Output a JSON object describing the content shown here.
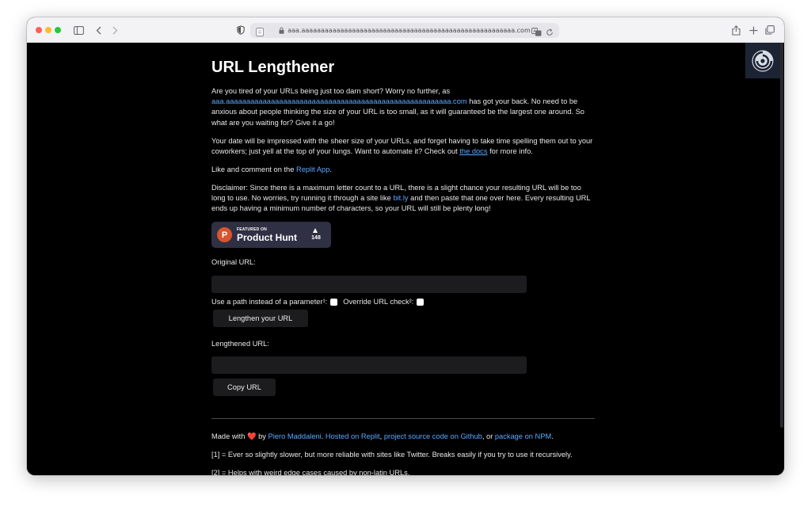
{
  "browser": {
    "url": "aaa.aaaaaaaaaaaaaaaaaaaaaaaaaaaaaaaaaaaaaaaaaaaaaaaaaaaaaaa.com"
  },
  "page": {
    "title": "URL Lengthener",
    "intro": {
      "before": "Are you tired of your URLs being just too darn short? Worry no further, as ",
      "link": "aaa.aaaaaaaaaaaaaaaaaaaaaaaaaaaaaaaaaaaaaaaaaaaaaaaaaaaaaaa.com",
      "after": " has got your back. No need to be anxious about people thinking the size of your URL is too small, as it will guaranteed be the largest one around. So what are you waiting for? Give it a go!"
    },
    "date": {
      "before": "Your date will be impressed with the sheer size of your URLs, and forget having to take time spelling them out to your coworkers; just yell at the top of your lungs. Want to automate it? Check out ",
      "link": "the docs",
      "after": " for more info."
    },
    "like": {
      "before": "Like and comment on the ",
      "link": "Replit App",
      "after": "."
    },
    "disclaimer": {
      "before": "Disclaimer: Since there is a maximum letter count to a URL, there is a slight chance your resulting URL will be too long to use. No worries, try running it through a site like ",
      "link": "bit.ly",
      "after": " and then paste that one over here. Every resulting URL ends up having a minimum number of characters, so your URL will still be plenty long!"
    },
    "product_hunt": {
      "featured": "FEATURED ON",
      "name": "Product Hunt",
      "count": "148"
    },
    "form": {
      "original_label": "Original URL:",
      "path_label": "Use a path instead of a parameter¹:",
      "override_label": "Override URL check²:",
      "lengthen_button": "Lengthen your URL",
      "lengthened_label": "Lengthened URL:",
      "copy_button": "Copy URL"
    },
    "footer": {
      "made_with": "Made with",
      "by": " by ",
      "author": "Piero Maddaleni",
      "sep1": ". ",
      "hosted": "Hosted on Replit",
      "sep2": ", ",
      "source": "project source code on Github",
      "sep3": ", or ",
      "npm": "package on NPM",
      "end": ".",
      "note1": "[1] = Ever so slightly slower, but more reliable with sites like Twitter. Breaks easily if you try to use it recursively.",
      "note2": "[2] = Helps with weird edge cases caused by non-latin URLs."
    }
  },
  "colors": {
    "background": "#000000",
    "link": "#5aa8ff",
    "product_hunt": "#da552f"
  }
}
